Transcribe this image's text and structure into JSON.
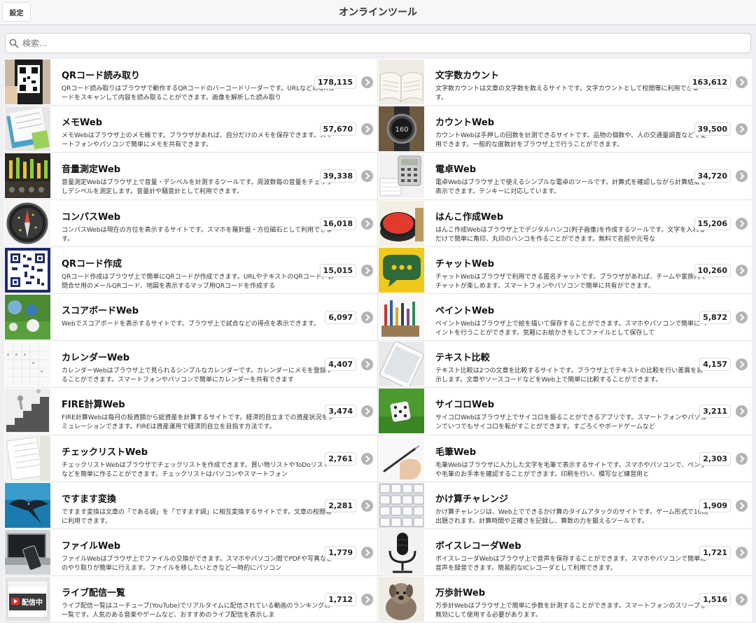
{
  "header": {
    "title": "オンラインツール",
    "settings_label": "設定"
  },
  "search": {
    "placeholder": "検索..."
  },
  "items": [
    {
      "title": "QRコード読み取り",
      "count": "178,115",
      "icon": "qr-reader-icon",
      "desc": "QRコード読み取りはブラウザで動作するQRコードのバーコードリーダーです。URLなどのQRコードをスキャンして内容を読み取ることができます。画像を解析した読み取り"
    },
    {
      "title": "文字数カウント",
      "count": "163,612",
      "icon": "open-book-icon",
      "desc": "文字数カウントは文章の文字数を数えるサイトです。文字カウントとして校閲等に利用できます。"
    },
    {
      "title": "メモWeb",
      "count": "57,670",
      "icon": "notebook-icon",
      "desc": "メモWebはブラウザ上のメモ帳です。ブラウザがあれば、自分だけのメモを保存できます。スマートフォンやパソコンで簡単にメモを共有できます。"
    },
    {
      "title": "カウントWeb",
      "count": "39,500",
      "icon": "counter-watch-icon",
      "desc": "カウントWebは手押しの回数を計測できるサイトです。品物の個数や、人の交通量調査などで使用できます。一般的な度数計をブラウザ上で行うことができます。"
    },
    {
      "title": "音量測定Web",
      "count": "39,338",
      "icon": "sound-meter-icon",
      "desc": "音量測定Webはブラウザ上で音量・デシベルを計測するツールです。周波数毎の音量をチェックしデシベルを測定します。音量計や騒音計として利用できます。"
    },
    {
      "title": "電卓Web",
      "count": "34,720",
      "icon": "calculator-icon",
      "desc": "電卓Webはブラウザ上で使えるシンプルな電卓のツールです。計算式を確認しながら計算結果を表示できます。テンキーに対応しています。"
    },
    {
      "title": "コンパスWeb",
      "count": "16,018",
      "icon": "compass-icon",
      "desc": "コンパスWebは現在の方位を表示するサイトです。スマホを羅針盤・方位磁石として利用できます。"
    },
    {
      "title": "はんこ作成Web",
      "count": "15,206",
      "icon": "stamp-pad-icon",
      "desc": "はんこ作成Webはブラウザ上でデジタルハンコ(判子画像)を作成するツールです。文字を入れるだけで簡単に角印、丸印のハンコを作ることができます。無料で名前や元号な"
    },
    {
      "title": "QRコード作成",
      "count": "15,015",
      "icon": "qr-code-icon",
      "desc": "QRコード作成はブラウザ上で簡単にQRコードが作成できます。URLやテキストのQRコード、お問合せ用のメールQRコード、地図を表示するマップ用QRコードを作成する"
    },
    {
      "title": "チャットWeb",
      "count": "10,260",
      "icon": "chat-bubble-icon",
      "desc": "チャットWebはブラウザで利用できる匿名チャットです。ブラウザがあれば、チームや家族内でチャットが楽しめます。スマートフォンやパソコンで簡単に共有ができます。"
    },
    {
      "title": "スコアボードWeb",
      "count": "6,097",
      "icon": "balls-icon",
      "desc": "Webでスコアボードを表示するサイトです。ブラウザ上で試合などの得点を表示できます。"
    },
    {
      "title": "ペイントWeb",
      "count": "5,872",
      "icon": "paint-brushes-icon",
      "desc": "ペイントWebはブラウザ上で絵を描いて保存することができます。スマホやパソコンで簡単にペイントを行うことができます。気軽にお絵かきをしてファイルとして保存して"
    },
    {
      "title": "カレンダーWeb",
      "count": "4,407",
      "icon": "calendar-icon",
      "desc": "カレンダーWebはブラウザ上で見られるシンプルなカレンダーです。カレンダーにメモを登録することができます。スマートフォンやパソコンで簡単にカレンダーを共有できます"
    },
    {
      "title": "テキスト比較",
      "count": "4,157",
      "icon": "tablet-icon",
      "desc": "テキスト比較は2つの文章を比較するサイトです。ブラウザ上でテキストの比較を行い差異を表示します。文章やソースコードなどをWeb上で簡単に比較することができます。"
    },
    {
      "title": "FIRE計算Web",
      "count": "3,474",
      "icon": "stairs-climb-icon",
      "desc": "FIRE計算Webは毎月の投資額から総資産を計算するサイトです。経済的自立までの資産状況をシミュレーションできます。FIREは資産運用で経済的自立を目指す方法です。"
    },
    {
      "title": "サイコロWeb",
      "count": "3,211",
      "icon": "dice-icon",
      "desc": "サイコロWebはブラウザ上でサイコロを振ることができるアプリです。スマートフォンやパソコンでいつでもサイコロを転がすことができます。すごろくやボードゲームなど"
    },
    {
      "title": "チェックリストWeb",
      "count": "2,761",
      "icon": "checklist-icon",
      "desc": "チェックリストWebはブラウザでチェックリストを作成できます。買い物リストやToDoリストなどを簡単に作ることができます。チェックリストはパソコンやスマートフォン"
    },
    {
      "title": "毛筆Web",
      "count": "2,303",
      "icon": "pen-hand-icon",
      "desc": "毛筆Webはブラウザに入力した文字を毛筆で表示するサイトです。スマホやパソコンで、ペン字や毛筆のお手本を確認することができます。印刷を行い、模写など練習用と"
    },
    {
      "title": "ですます変換",
      "count": "2,281",
      "icon": "manta-ray-icon",
      "desc": "ですます変換は文章の「である調」を「ですます調」に相互変換するサイトです。文章の校閲等に利用できます。"
    },
    {
      "title": "かけ算チャレンジ",
      "count": "1,909",
      "icon": "keypad-icon",
      "desc": "かけ算チャレンジは、Web上でできるかけ算のタイムアタックのサイトです。ゲーム形式で10問出題されます。計算時間や正確さを記録し、算数の力を鍛えるツールです。"
    },
    {
      "title": "ファイルWeb",
      "count": "1,779",
      "icon": "laptop-phone-icon",
      "desc": "ファイルWebはブラウザ上でファイルの交換ができます。スマホやパソコン間でPDFや写真などのやり取りが簡単に行えます。ファイルを移したいときなど一時的にパソコン"
    },
    {
      "title": "ボイスレコーダWeb",
      "count": "1,721",
      "icon": "microphone-icon",
      "desc": "ボイスレコーダWebはブラウザ上で音声を保存することができます。スマホやパソコンで簡単に音声を録音できます。簡易的なICレコーダとして利用できます。"
    },
    {
      "title": "ライブ配信一覧",
      "count": "1,712",
      "icon": "live-stream-icon",
      "thumb_text": "配信中",
      "desc": "ライブ配信一覧はユーチューブ(YouTube)でリアルタイムに配信されている動画のランキングの一覧です。人気のある音楽やゲームなど、おすすめのライブ配信を表示しま"
    },
    {
      "title": "万歩計Web",
      "count": "1,516",
      "icon": "dog-icon",
      "desc": "万歩計Webはブラウザ上で簡単に歩数を計測することができます。スマートフォンのスリープを無効にして使用する必要があります。"
    }
  ]
}
